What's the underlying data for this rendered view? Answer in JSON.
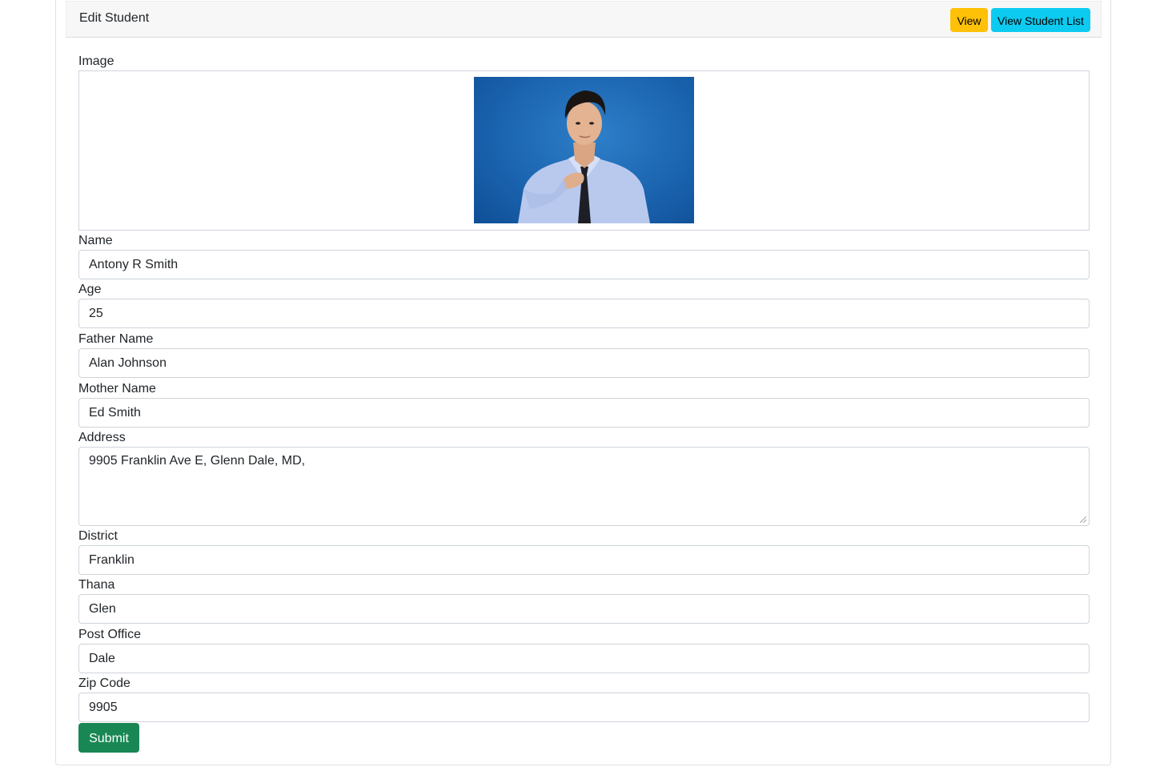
{
  "header": {
    "title": "Edit Student",
    "view_label": "View",
    "list_label": "View Student List"
  },
  "form": {
    "image_label": "Image",
    "name_label": "Name",
    "name_value": "Antony R Smith",
    "age_label": "Age",
    "age_value": "25",
    "father_label": "Father Name",
    "father_value": "Alan Johnson",
    "mother_label": "Mother Name",
    "mother_value": "Ed Smith",
    "address_label": "Address",
    "address_value": "9905 Franklin Ave E, Glenn Dale, MD,",
    "district_label": "District",
    "district_value": "Franklin",
    "thana_label": "Thana",
    "thana_value": "Glen",
    "post_label": "Post Office",
    "post_value": "Dale",
    "zip_label": "Zip Code",
    "zip_value": "9905",
    "submit_label": "Submit"
  },
  "colors": {
    "view_button": "#ffc107",
    "list_button": "#0dcaf0",
    "submit_button": "#198754",
    "photo_background": "#1b64b0"
  }
}
